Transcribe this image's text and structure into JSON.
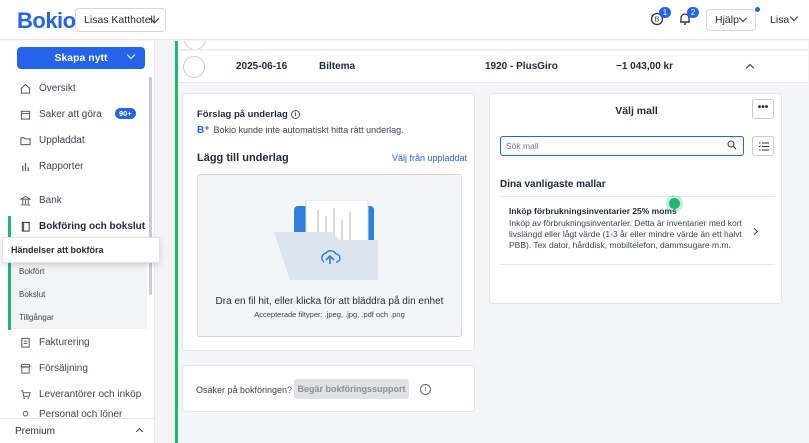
{
  "header": {
    "logo": "Bokio",
    "company": "Lisas Katthotell",
    "notifications": [
      {
        "icon": "coin-icon",
        "count": "1"
      },
      {
        "icon": "bell-icon",
        "count": "2"
      }
    ],
    "help_label": "Hjälp",
    "user_label": "Lisa"
  },
  "sidebar": {
    "create_label": "Skapa nytt",
    "items": [
      {
        "name": "overview",
        "label": "Översikt",
        "icon": "home-icon"
      },
      {
        "name": "todo",
        "label": "Saker att göra",
        "icon": "calendar-icon",
        "badge": "90+"
      },
      {
        "name": "uploaded",
        "label": "Uppladdat",
        "icon": "folder-icon"
      },
      {
        "name": "reports",
        "label": "Rapporter",
        "icon": "bar-chart-icon"
      },
      {
        "name": "bank",
        "label": "Bank",
        "icon": "bank-icon"
      },
      {
        "name": "bookkeeping",
        "label": "Bokföring och bokslut",
        "icon": "book-icon"
      }
    ],
    "sub_items": [
      "Bokfört",
      "Bokslut",
      "Tillgångar"
    ],
    "items_after": [
      {
        "name": "invoicing",
        "label": "Fakturering",
        "icon": "invoice-icon"
      },
      {
        "name": "sales",
        "label": "Försäljning",
        "icon": "store-icon"
      },
      {
        "name": "suppliers",
        "label": "Leverantörer och inköp",
        "icon": "cart-icon"
      },
      {
        "name": "salary",
        "label": "Personal och löner",
        "icon": "person-icon"
      }
    ],
    "tooltip": "Händelser att bokföra",
    "premium": "Premium"
  },
  "transaction": {
    "date": "2025-06-16",
    "description": "Biltema",
    "account": "1920 - PlusGiro",
    "amount": "−1 043,00 kr"
  },
  "suggestion": {
    "title": "Förslag på underlag",
    "ai_text": "Bokio kunde inte automatiskt hitta rätt underlag.",
    "add_title": "Lägg till underlag",
    "choose_uploaded": "Välj från uppladdat",
    "drop_text": "Dra en fil hit, eller klicka för att bläddra på din enhet",
    "accepted_types": "Accepterade filtyper: .jpeg, .jpg, .pdf och .png"
  },
  "support": {
    "question": "Osäker på bokföringen?",
    "button": "Begär bokföringssupport"
  },
  "template": {
    "title": "Välj mall",
    "more_label": "•••",
    "search_placeholder": "Sök mall",
    "frequent_title": "Dina vanligaste mallar",
    "items": [
      {
        "name": "Inköp förbrukningsinventarier 25% moms",
        "description": "Inköp av förbrukningsinventarier. Detta är inventarier med kort livslängd eller lågt värde (1-3 år eller mindre värde än ett halvt PBB). Tex dator, hårddisk, mobiltelefon, dammsugare m.m."
      }
    ]
  },
  "colors": {
    "brand": "#2563eb",
    "accent": "#22b573"
  }
}
